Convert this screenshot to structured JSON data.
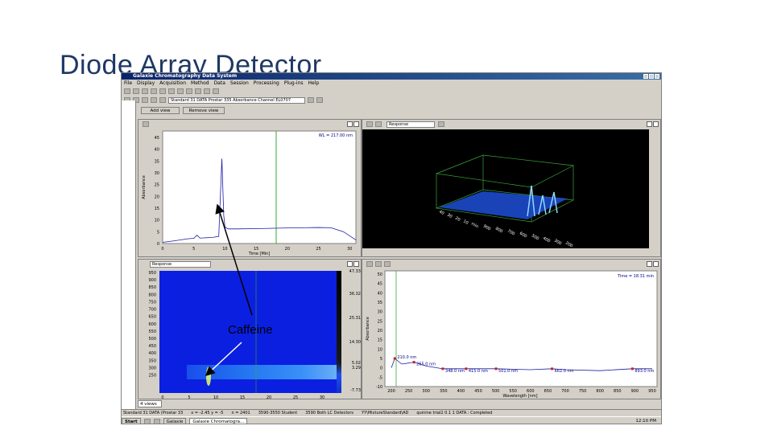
{
  "slide": {
    "title": "Diode Array Detector"
  },
  "window": {
    "title": "Galaxie Chromatography Data System",
    "menu": [
      "File",
      "Display",
      "Acquisition",
      "Method",
      "Data",
      "Session",
      "Processing",
      "Plug-ins",
      "Help"
    ],
    "channel_select": "Standard 31 DATA Prostar 335 Absorbance Channel EL0707"
  },
  "view_buttons": {
    "add": "Add view",
    "remove": "Remove view"
  },
  "chromatogram": {
    "wl_label": "WL = 217.00 nm",
    "ylabel": "Absorbance",
    "xlabel": "Time [Min]",
    "yticks": [
      "45",
      "40",
      "35",
      "30",
      "25",
      "20",
      "15",
      "10",
      "5",
      "0"
    ],
    "xticks": [
      "0",
      "5",
      "10",
      "15",
      "20",
      "25",
      "30"
    ]
  },
  "plot3d": {
    "response_label": "Response",
    "axis_labels": [
      "40",
      "30",
      "20",
      "10",
      "min",
      "900",
      "800",
      "700",
      "600",
      "500",
      "400",
      "300",
      "200"
    ]
  },
  "contour": {
    "response_label": "Response",
    "yticks": [
      "950",
      "900",
      "850",
      "800",
      "750",
      "700",
      "650",
      "600",
      "550",
      "500",
      "450",
      "400",
      "350",
      "300",
      "250"
    ],
    "xticks": [
      "0",
      "5",
      "10",
      "15",
      "20",
      "25",
      "30"
    ],
    "scale_labels": [
      "47.33",
      "36.32",
      "25.31",
      "14.30",
      "5.02",
      "3.29",
      "-7.73"
    ]
  },
  "spectrum": {
    "time_label": "Time = 18.31 min",
    "ylabel": "Absorbance",
    "xlabel": "Wavelength [nm]",
    "yticks": [
      "50",
      "45",
      "40",
      "35",
      "30",
      "25",
      "20",
      "15",
      "10",
      "5",
      "0",
      "-5",
      "-10"
    ],
    "xticks": [
      "200",
      "250",
      "300",
      "350",
      "400",
      "450",
      "500",
      "550",
      "600",
      "650",
      "700",
      "750",
      "800",
      "850",
      "900",
      "950"
    ],
    "peak_labels": [
      "210.0 nm",
      "265.0 nm",
      "348.0 nm",
      "415.0 nm",
      "501.0 nm",
      "662.0 nm",
      "893.0 nm"
    ]
  },
  "statusbar": [
    "Standard 31 DATA (Prostar 33",
    "x = -2.45 y = -5",
    "n = 2401",
    "3590-3550 Student",
    "3590 Both LC Detectors",
    "YY\\MixtureStandard\\AD",
    "quinine trial2 0.1 1 DATA : Completed"
  ],
  "views_tab": "4 views",
  "taskbar": {
    "start": "Start",
    "items": [
      "Galaxie",
      "Galaxie Chromatogra..."
    ],
    "clock": "12:10 PM"
  },
  "annotation": {
    "label": "Caffeine"
  },
  "chart_data": [
    {
      "type": "line",
      "x": [
        0,
        2,
        4,
        5,
        5.5,
        6,
        8,
        9.0,
        9.5,
        9.8,
        10.0,
        10.5,
        12,
        15,
        20,
        25,
        27,
        29,
        31
      ],
      "y": [
        0.5,
        1.2,
        2.0,
        2.2,
        3.5,
        2.3,
        2.6,
        3.0,
        36,
        12,
        7,
        6.2,
        6.2,
        6.3,
        6.6,
        6.8,
        6.7,
        5.0,
        1.5
      ],
      "xlabel": "Time [Min]",
      "ylabel": "Absorbance",
      "xlim": [
        0,
        31
      ],
      "ylim": [
        0,
        45
      ]
    },
    {
      "type": "line",
      "x": [
        200,
        210,
        230,
        265,
        300,
        348,
        415,
        501,
        600,
        662,
        700,
        800,
        893,
        950
      ],
      "y": [
        0,
        5,
        2,
        3,
        1,
        -0.5,
        -0.5,
        -0.5,
        -1,
        -0.5,
        -1,
        -1.5,
        -0.5,
        -0.5
      ],
      "xlabel": "Wavelength [nm]",
      "ylabel": "Absorbance",
      "xlim": [
        200,
        950
      ],
      "ylim": [
        -10,
        50
      ]
    }
  ]
}
